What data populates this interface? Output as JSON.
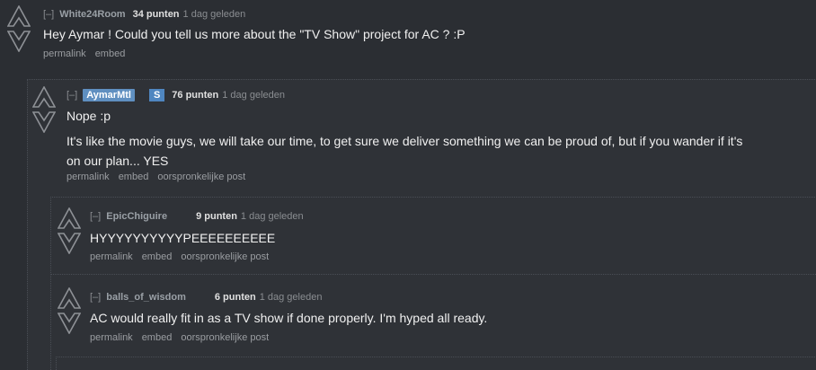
{
  "comments": [
    {
      "expand": "[–]",
      "author": "White24Room",
      "score": "34 punten",
      "time": "1 dag geleden",
      "body": [
        "Hey Aymar ! Could you tell us more about the \"TV Show\" project for AC ? :P"
      ],
      "links": [
        "permalink",
        "embed"
      ]
    },
    {
      "expand": "[–]",
      "author": "AymarMtl",
      "flair": "S",
      "score": "76 punten",
      "time": "1 dag geleden",
      "body": [
        "Nope :p",
        "It's like the movie guys, we will take our time, to get sure we deliver something we can be proud of, but if you wander if it's",
        "on our plan... YES"
      ],
      "links": [
        "permalink",
        "embed",
        "oorspronkelijke post"
      ]
    },
    {
      "expand": "[–]",
      "author": "EpicChiguire",
      "score": "9 punten",
      "time": "1 dag geleden",
      "body": [
        "HYYYYYYYYYYPEEEEEEEEEE"
      ],
      "links": [
        "permalink",
        "embed",
        "oorspronkelijke post"
      ]
    },
    {
      "expand": "[–]",
      "author": "balls_of_wisdom",
      "score": "6 punten",
      "time": "1 dag geleden",
      "body": [
        "AC would really fit in as a TV show if done properly. I'm hyped all ready."
      ],
      "links": [
        "permalink",
        "embed",
        "oorspronkelijke post"
      ]
    }
  ],
  "icons": {
    "upvote": "assassin-insignia-up-icon",
    "downvote": "assassin-insignia-down-icon"
  },
  "colors": {
    "background": "#2b2e33",
    "flair": "#4f86c0",
    "submitter": "#5f8fc0"
  }
}
